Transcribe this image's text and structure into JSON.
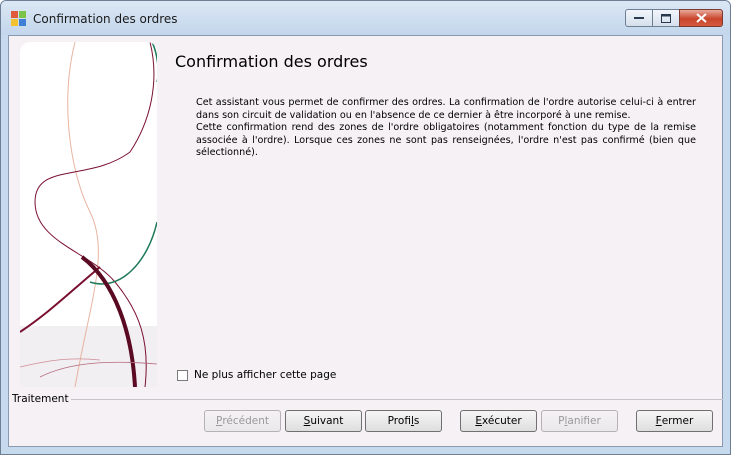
{
  "window": {
    "title": "Confirmation des ordres",
    "icon": "app-icon",
    "controls": {
      "minimize": "minimize-icon",
      "maximize": "maximize-icon",
      "close": "close-icon"
    }
  },
  "page": {
    "title": "Confirmation des ordres",
    "paragraph1": "Cet assistant vous permet de confirmer des ordres. La confirmation de l'ordre autorise celui-ci à entrer dans son circuit de validation ou en l'absence de ce dernier à être incorporé à une remise.",
    "paragraph2": "Cette confirmation rend des zones de l'ordre obligatoires (notamment fonction du type de la remise associée à l'ordre). Lorsque ces zones ne sont pas renseignées, l'ordre n'est pas confirmé (bien que sélectionné).",
    "checkbox_label": "Ne plus afficher cette page",
    "checkbox_checked": false
  },
  "footer": {
    "group_label": "Traitement",
    "buttons": {
      "precedent": {
        "first": "P",
        "rest": "récédent",
        "enabled": false
      },
      "suivant": {
        "first": "S",
        "rest": "uivant",
        "enabled": true
      },
      "profils": {
        "pre": "Profi",
        "u": "l",
        "post": "s",
        "enabled": true
      },
      "executer": {
        "first": "E",
        "rest": "xécuter",
        "enabled": true
      },
      "planifier": {
        "pre": "P",
        "u": "l",
        "post": "anifier",
        "enabled": false
      },
      "fermer": {
        "first": "F",
        "rest": "ermer",
        "enabled": true
      }
    }
  },
  "colors": {
    "accent_wine": "#7a1030",
    "accent_green": "#1f7a5a",
    "accent_peach": "#e8b4a0"
  }
}
